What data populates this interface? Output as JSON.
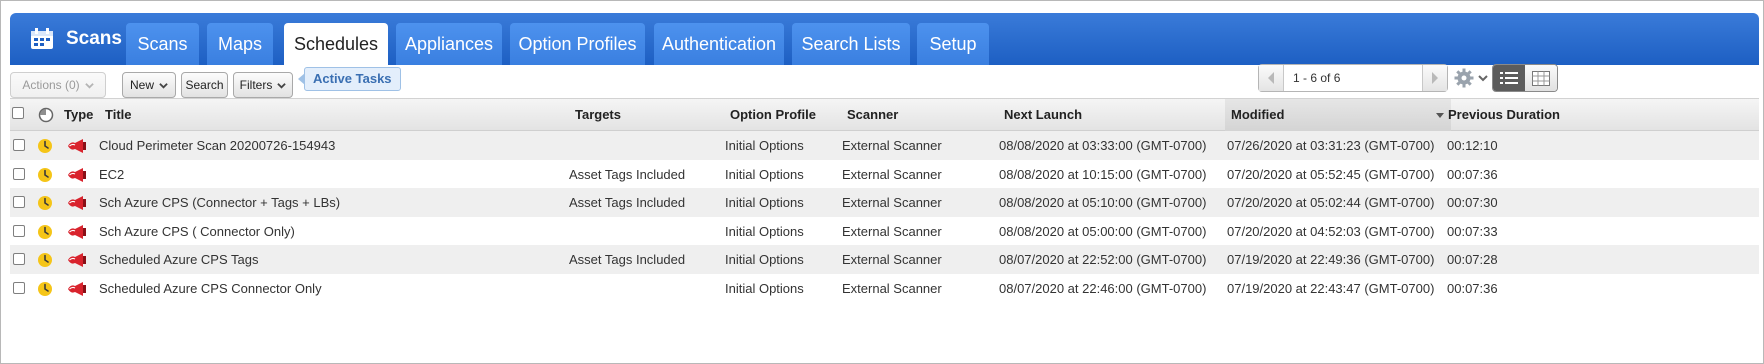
{
  "module": {
    "title": "Scans",
    "icon": "calendar-icon"
  },
  "tabs": [
    {
      "label": "Scans"
    },
    {
      "label": "Maps"
    },
    {
      "label": "Schedules",
      "active": true
    },
    {
      "label": "Appliances"
    },
    {
      "label": "Option Profiles"
    },
    {
      "label": "Authentication"
    },
    {
      "label": "Search Lists"
    },
    {
      "label": "Setup"
    }
  ],
  "toolbar": {
    "actions_label": "Actions (0)",
    "new_label": "New",
    "search_label": "Search",
    "filters_label": "Filters",
    "active_filter": "Active Tasks",
    "pager_range": "1 - 6 of 6"
  },
  "columns": {
    "type": "Type",
    "title": "Title",
    "targets": "Targets",
    "option_profile": "Option Profile",
    "scanner": "Scanner",
    "next_launch": "Next Launch",
    "modified": "Modified",
    "previous_duration": "Previous Duration"
  },
  "rows": [
    {
      "title": "Cloud Perimeter Scan 20200726-154943",
      "targets": "",
      "option_profile": "Initial Options",
      "scanner": "External Scanner",
      "next_launch": "08/08/2020 at 03:33:00 (GMT-0700)",
      "modified": "07/26/2020 at 03:31:23 (GMT-0700)",
      "previous_duration": "00:12:10"
    },
    {
      "title": "EC2",
      "targets": "Asset Tags Included",
      "option_profile": "Initial Options",
      "scanner": "External Scanner",
      "next_launch": "08/08/2020 at 10:15:00 (GMT-0700)",
      "modified": "07/20/2020 at 05:52:45 (GMT-0700)",
      "previous_duration": "00:07:36"
    },
    {
      "title": "Sch Azure CPS (Connector + Tags + LBs)",
      "targets": "Asset Tags Included",
      "option_profile": "Initial Options",
      "scanner": "External Scanner",
      "next_launch": "08/08/2020 at 05:10:00 (GMT-0700)",
      "modified": "07/20/2020 at 05:02:44 (GMT-0700)",
      "previous_duration": "00:07:30"
    },
    {
      "title": "Sch Azure CPS ( Connector Only)",
      "targets": "",
      "option_profile": "Initial Options",
      "scanner": "External Scanner",
      "next_launch": "08/08/2020 at 05:00:00 (GMT-0700)",
      "modified": "07/20/2020 at 04:52:03 (GMT-0700)",
      "previous_duration": "00:07:33"
    },
    {
      "title": "Scheduled Azure CPS Tags",
      "targets": "Asset Tags Included",
      "option_profile": "Initial Options",
      "scanner": "External Scanner",
      "next_launch": "08/07/2020 at 22:52:00 (GMT-0700)",
      "modified": "07/19/2020 at 22:49:36 (GMT-0700)",
      "previous_duration": "00:07:28"
    },
    {
      "title": "Scheduled Azure CPS Connector Only",
      "targets": "",
      "option_profile": "Initial Options",
      "scanner": "External Scanner",
      "next_launch": "08/07/2020 at 22:46:00 (GMT-0700)",
      "modified": "07/19/2020 at 22:43:47 (GMT-0700)",
      "previous_duration": "00:07:36"
    }
  ],
  "colors": {
    "header_blue": "#1d5fc3",
    "tab_blue": "#3a7fe0",
    "clock_yellow": "#f5c518",
    "scanner_red": "#d9232d"
  },
  "icons": {
    "status": "clock-icon",
    "type": "external-scanner-icon",
    "settings": "gear-icon",
    "list_view": "list-view-icon",
    "grid_view": "grid-view-icon"
  }
}
